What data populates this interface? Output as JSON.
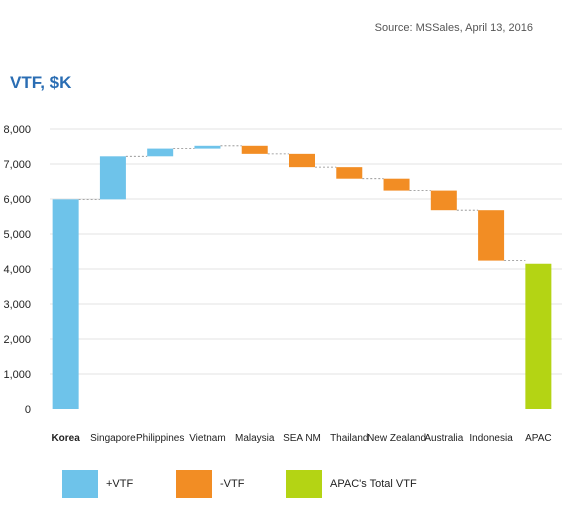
{
  "source": "Source: MSSales, April 13, 2016",
  "title": "VTF, $K",
  "colors": {
    "increase": "#6ec3ea",
    "decrease": "#f28d24",
    "total": "#b4d414",
    "grid": "#e3e3e3",
    "connector": "#8a8a8a"
  },
  "legend": [
    {
      "label": "+VTF",
      "color": "#6ec3ea"
    },
    {
      "label": "-VTF",
      "color": "#f28d24"
    },
    {
      "label": "APAC's Total VTF",
      "color": "#b4d414"
    }
  ],
  "chart_data": {
    "type": "bar",
    "subtype": "waterfall",
    "title": "VTF, $K",
    "xlabel": "",
    "ylabel": "",
    "ylim": [
      0,
      8000
    ],
    "yticks": [
      0,
      1000,
      2000,
      3000,
      4000,
      5000,
      6000,
      7000,
      8000
    ],
    "ytick_labels": [
      "0",
      "1,000",
      "2,000",
      "3,000",
      "4,000",
      "5,000",
      "6,000",
      "7,000",
      "8,000"
    ],
    "grid": true,
    "legend_position": "bottom",
    "categories": [
      "Korea",
      "Singapore",
      "Philippines",
      "Vietnam",
      "Malaysia",
      "SEA NM",
      "Thailand",
      "New Zealand",
      "Australia",
      "Indonesia",
      "APAC"
    ],
    "values": [
      5990,
      1230,
      220,
      80,
      -230,
      -380,
      -330,
      -340,
      -560,
      -1440,
      4150
    ],
    "kinds": [
      "increase",
      "increase",
      "increase",
      "increase",
      "decrease",
      "decrease",
      "decrease",
      "decrease",
      "decrease",
      "decrease",
      "total"
    ],
    "bold_categories": [
      "Korea"
    ]
  }
}
